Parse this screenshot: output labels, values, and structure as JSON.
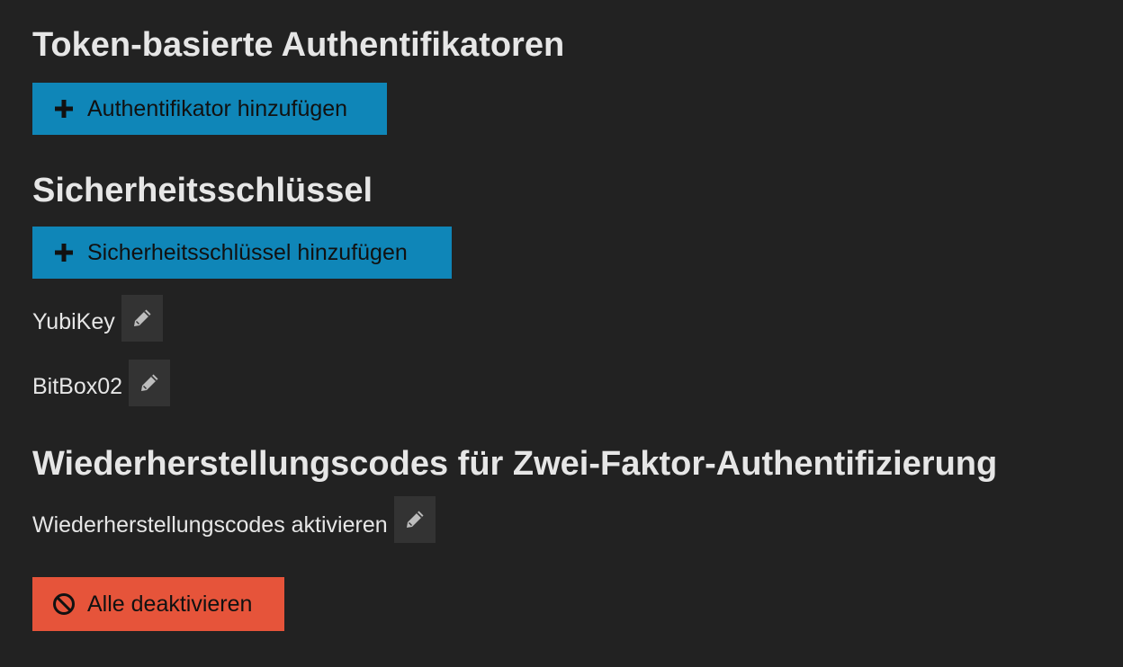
{
  "sections": {
    "token": {
      "heading": "Token-basierte Authentifikatoren",
      "add_button_label": "Authentifikator hinzufügen",
      "add_button_icon": "plus-icon"
    },
    "security_keys": {
      "heading": "Sicherheitsschlüssel",
      "add_button_label": "Sicherheitsschlüssel hinzufügen",
      "add_button_icon": "plus-icon",
      "keys": [
        {
          "name": "YubiKey",
          "edit_icon": "pencil-icon"
        },
        {
          "name": "BitBox02",
          "edit_icon": "pencil-icon"
        }
      ]
    },
    "recovery": {
      "heading": "Wiederherstellungscodes für Zwei-Faktor-Authentifizierung",
      "enable_label": "Wiederherstellungscodes aktivieren",
      "edit_icon": "pencil-icon"
    }
  },
  "disable_all": {
    "label": "Alle deaktivieren",
    "icon": "ban-icon"
  },
  "colors": {
    "background": "#222222",
    "text": "#e6e6e6",
    "primary_button": "#0f86b8",
    "danger_button": "#e6543a",
    "edit_button_bg": "#333333"
  }
}
